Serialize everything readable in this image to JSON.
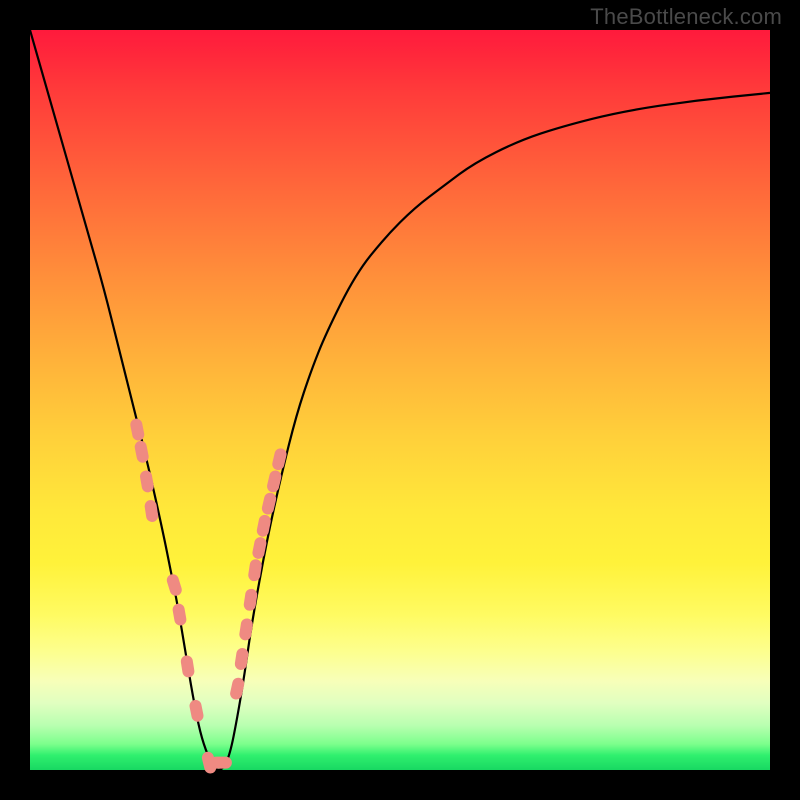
{
  "watermark": "TheBottleneck.com",
  "colors": {
    "frame": "#000000",
    "curve": "#000000",
    "marker": "#ef8a82",
    "marker_stroke": "#c86a64"
  },
  "chart_data": {
    "type": "line",
    "title": "",
    "xlabel": "",
    "ylabel": "",
    "xlim": [
      0,
      100
    ],
    "ylim": [
      0,
      100
    ],
    "x": [
      0,
      2,
      4,
      6,
      8,
      10,
      12,
      14,
      16,
      18,
      19,
      20,
      21,
      22,
      23,
      24,
      25,
      26,
      27,
      28,
      29,
      30,
      32,
      34,
      36,
      38,
      40,
      44,
      48,
      52,
      56,
      60,
      66,
      72,
      80,
      90,
      100
    ],
    "values": [
      100,
      93,
      86,
      79,
      72,
      65,
      57,
      49,
      41,
      32,
      27,
      22,
      16,
      10,
      5,
      2,
      0,
      0,
      2,
      7,
      13,
      20,
      31,
      40,
      48,
      54,
      59,
      67,
      72,
      76,
      79,
      82,
      85,
      87,
      89,
      90.5,
      91.5
    ],
    "markers_x": [
      14.5,
      15.1,
      15.8,
      16.4,
      19.5,
      20.2,
      21.3,
      22.5,
      24.2,
      25.8,
      28.0,
      28.6,
      29.2,
      29.8,
      30.4,
      31.0,
      31.6,
      32.3,
      33.0,
      33.7
    ],
    "markers_y": [
      46,
      43,
      39,
      35,
      25,
      21,
      14,
      8,
      1,
      1,
      11,
      15,
      19,
      23,
      27,
      30,
      33,
      36,
      39,
      42
    ],
    "annotations": []
  }
}
